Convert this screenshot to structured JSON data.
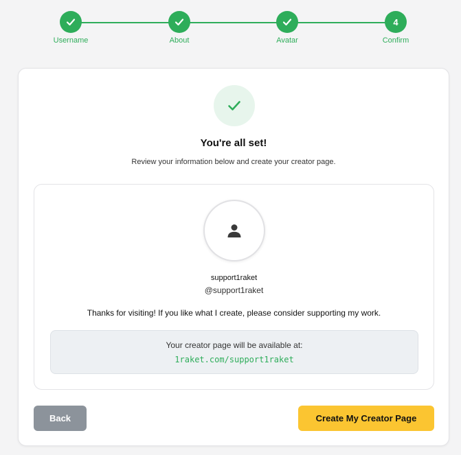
{
  "stepper": {
    "steps": [
      {
        "label": "Username",
        "state": "complete",
        "icon": "check-icon"
      },
      {
        "label": "About",
        "state": "complete",
        "icon": "check-icon"
      },
      {
        "label": "Avatar",
        "state": "complete",
        "icon": "check-icon"
      },
      {
        "label": "Confirm",
        "state": "current",
        "number": "4"
      }
    ]
  },
  "confirm": {
    "title": "You're all set!",
    "subtitle": "Review your information below and create your creator page."
  },
  "preview": {
    "avatar_icon": "user-icon",
    "display_name": "support1raket",
    "handle": "@support1raket",
    "bio": "Thanks for visiting! If you like what I create, please consider supporting my work.",
    "url_label": "Your creator page will be available at:",
    "url": "1raket.com/support1raket"
  },
  "actions": {
    "back_label": "Back",
    "create_label": "Create My Creator Page"
  },
  "colors": {
    "accent_green": "#2ead5a",
    "primary_yellow": "#fbc531",
    "back_gray": "#8c939b"
  }
}
